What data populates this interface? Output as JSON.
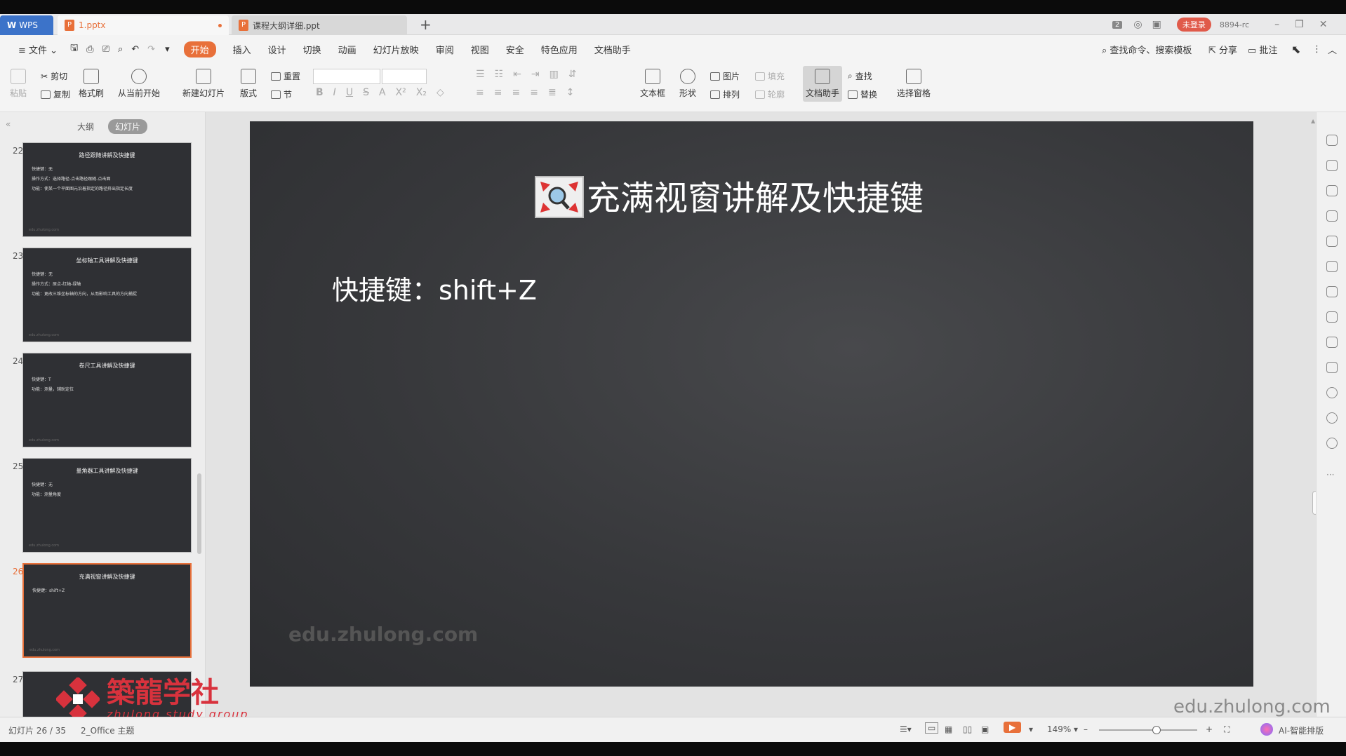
{
  "tabs": [
    {
      "label": "WPS"
    },
    {
      "label": "1.pptx"
    },
    {
      "label": "课程大纲详细.ppt"
    }
  ],
  "titlebar": {
    "plus": "+",
    "page_count": "2",
    "login_label": "未登录",
    "user_code": "8894-rc"
  },
  "menu": {
    "file": "文件",
    "items": [
      "开始",
      "插入",
      "设计",
      "切换",
      "动画",
      "幻灯片放映",
      "审阅",
      "视图",
      "安全",
      "特色应用",
      "文档助手"
    ],
    "search": "查找命令、搜索模板",
    "share": "分享",
    "comment": "批注"
  },
  "ribbon": {
    "paste": "粘贴",
    "cut": "剪切",
    "copy": "复制",
    "format_painter": "格式刷",
    "from_current": "从当前开始",
    "new_slide": "新建幻灯片",
    "layout": "版式",
    "reset": "重置",
    "section": "节",
    "text_box": "文本框",
    "shape": "形状",
    "picture": "图片",
    "fill": "填充",
    "arrange": "排列",
    "outline": "轮廓",
    "doc_assistant": "文档助手",
    "find": "查找",
    "replace": "替换",
    "select_pane": "选择窗格"
  },
  "left_panel": {
    "tab_outline": "大纲",
    "tab_slides": "幻灯片",
    "thumbnails": [
      {
        "num": "22",
        "title": "路径跟随讲解及快捷键",
        "lines": [
          "快捷键：无",
          "操作方式：选择路径-点击路径跟随-点击面",
          "功能：使某一个平面图元沿着指定的路径挤出指定长度"
        ]
      },
      {
        "num": "23",
        "title": "坐标轴工具讲解及快捷键",
        "lines": [
          "快捷键：无",
          "操作方式：原点-红轴-绿轴",
          "功能：更改三维坐标轴的方向，从而影响工具的方向捕捉"
        ]
      },
      {
        "num": "24",
        "title": "卷尺工具讲解及快捷键",
        "lines": [
          "快捷键：T",
          "功能：测量，辅助定位"
        ]
      },
      {
        "num": "25",
        "title": "量角器工具讲解及快捷键",
        "lines": [
          "快捷键：无",
          "功能：测量角度"
        ]
      },
      {
        "num": "26",
        "title": "充满视窗讲解及快捷键",
        "lines": [
          "快捷键：shift+Z"
        ]
      },
      {
        "num": "27",
        "title": "",
        "lines": []
      }
    ],
    "thumb_watermark": "edu.zhulong.com"
  },
  "slide": {
    "title": "充满视窗讲解及快捷键",
    "body": "快捷键：shift+Z",
    "watermark": "edu.zhulong.com"
  },
  "overlay_watermark": "edu.zhulong.com",
  "logo": {
    "cn": "築龍学社",
    "en": "zhulong study group"
  },
  "status": {
    "slide_info": "幻灯片 26 / 35",
    "theme": "2_Office 主题",
    "zoom": "149%",
    "ai_layout": "AI-智能排版"
  },
  "colors": {
    "accent": "#e8703a",
    "wps_blue": "#3c73c9",
    "logo_red": "#d8323d",
    "slide_bg": "#37383b"
  }
}
